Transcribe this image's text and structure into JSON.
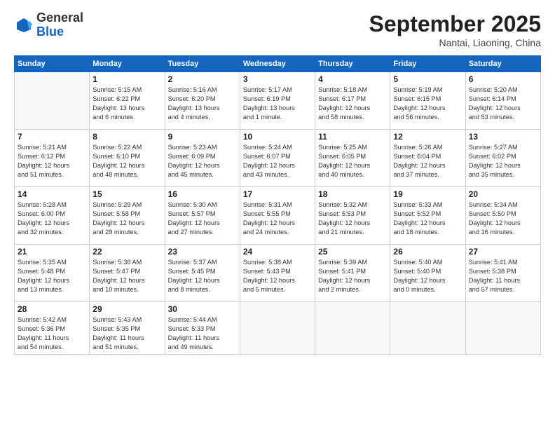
{
  "header": {
    "logo_general": "General",
    "logo_blue": "Blue",
    "month": "September 2025",
    "location": "Nantai, Liaoning, China"
  },
  "days_of_week": [
    "Sunday",
    "Monday",
    "Tuesday",
    "Wednesday",
    "Thursday",
    "Friday",
    "Saturday"
  ],
  "weeks": [
    [
      {
        "day": "",
        "info": ""
      },
      {
        "day": "1",
        "info": "Sunrise: 5:15 AM\nSunset: 6:22 PM\nDaylight: 13 hours\nand 6 minutes."
      },
      {
        "day": "2",
        "info": "Sunrise: 5:16 AM\nSunset: 6:20 PM\nDaylight: 13 hours\nand 4 minutes."
      },
      {
        "day": "3",
        "info": "Sunrise: 5:17 AM\nSunset: 6:19 PM\nDaylight: 13 hours\nand 1 minute."
      },
      {
        "day": "4",
        "info": "Sunrise: 5:18 AM\nSunset: 6:17 PM\nDaylight: 12 hours\nand 58 minutes."
      },
      {
        "day": "5",
        "info": "Sunrise: 5:19 AM\nSunset: 6:15 PM\nDaylight: 12 hours\nand 56 minutes."
      },
      {
        "day": "6",
        "info": "Sunrise: 5:20 AM\nSunset: 6:14 PM\nDaylight: 12 hours\nand 53 minutes."
      }
    ],
    [
      {
        "day": "7",
        "info": "Sunrise: 5:21 AM\nSunset: 6:12 PM\nDaylight: 12 hours\nand 51 minutes."
      },
      {
        "day": "8",
        "info": "Sunrise: 5:22 AM\nSunset: 6:10 PM\nDaylight: 12 hours\nand 48 minutes."
      },
      {
        "day": "9",
        "info": "Sunrise: 5:23 AM\nSunset: 6:09 PM\nDaylight: 12 hours\nand 45 minutes."
      },
      {
        "day": "10",
        "info": "Sunrise: 5:24 AM\nSunset: 6:07 PM\nDaylight: 12 hours\nand 43 minutes."
      },
      {
        "day": "11",
        "info": "Sunrise: 5:25 AM\nSunset: 6:05 PM\nDaylight: 12 hours\nand 40 minutes."
      },
      {
        "day": "12",
        "info": "Sunrise: 5:26 AM\nSunset: 6:04 PM\nDaylight: 12 hours\nand 37 minutes."
      },
      {
        "day": "13",
        "info": "Sunrise: 5:27 AM\nSunset: 6:02 PM\nDaylight: 12 hours\nand 35 minutes."
      }
    ],
    [
      {
        "day": "14",
        "info": "Sunrise: 5:28 AM\nSunset: 6:00 PM\nDaylight: 12 hours\nand 32 minutes."
      },
      {
        "day": "15",
        "info": "Sunrise: 5:29 AM\nSunset: 5:58 PM\nDaylight: 12 hours\nand 29 minutes."
      },
      {
        "day": "16",
        "info": "Sunrise: 5:30 AM\nSunset: 5:57 PM\nDaylight: 12 hours\nand 27 minutes."
      },
      {
        "day": "17",
        "info": "Sunrise: 5:31 AM\nSunset: 5:55 PM\nDaylight: 12 hours\nand 24 minutes."
      },
      {
        "day": "18",
        "info": "Sunrise: 5:32 AM\nSunset: 5:53 PM\nDaylight: 12 hours\nand 21 minutes."
      },
      {
        "day": "19",
        "info": "Sunrise: 5:33 AM\nSunset: 5:52 PM\nDaylight: 12 hours\nand 18 minutes."
      },
      {
        "day": "20",
        "info": "Sunrise: 5:34 AM\nSunset: 5:50 PM\nDaylight: 12 hours\nand 16 minutes."
      }
    ],
    [
      {
        "day": "21",
        "info": "Sunrise: 5:35 AM\nSunset: 5:48 PM\nDaylight: 12 hours\nand 13 minutes."
      },
      {
        "day": "22",
        "info": "Sunrise: 5:36 AM\nSunset: 5:47 PM\nDaylight: 12 hours\nand 10 minutes."
      },
      {
        "day": "23",
        "info": "Sunrise: 5:37 AM\nSunset: 5:45 PM\nDaylight: 12 hours\nand 8 minutes."
      },
      {
        "day": "24",
        "info": "Sunrise: 5:38 AM\nSunset: 5:43 PM\nDaylight: 12 hours\nand 5 minutes."
      },
      {
        "day": "25",
        "info": "Sunrise: 5:39 AM\nSunset: 5:41 PM\nDaylight: 12 hours\nand 2 minutes."
      },
      {
        "day": "26",
        "info": "Sunrise: 5:40 AM\nSunset: 5:40 PM\nDaylight: 12 hours\nand 0 minutes."
      },
      {
        "day": "27",
        "info": "Sunrise: 5:41 AM\nSunset: 5:38 PM\nDaylight: 11 hours\nand 57 minutes."
      }
    ],
    [
      {
        "day": "28",
        "info": "Sunrise: 5:42 AM\nSunset: 5:36 PM\nDaylight: 11 hours\nand 54 minutes."
      },
      {
        "day": "29",
        "info": "Sunrise: 5:43 AM\nSunset: 5:35 PM\nDaylight: 11 hours\nand 51 minutes."
      },
      {
        "day": "30",
        "info": "Sunrise: 5:44 AM\nSunset: 5:33 PM\nDaylight: 11 hours\nand 49 minutes."
      },
      {
        "day": "",
        "info": ""
      },
      {
        "day": "",
        "info": ""
      },
      {
        "day": "",
        "info": ""
      },
      {
        "day": "",
        "info": ""
      }
    ]
  ]
}
